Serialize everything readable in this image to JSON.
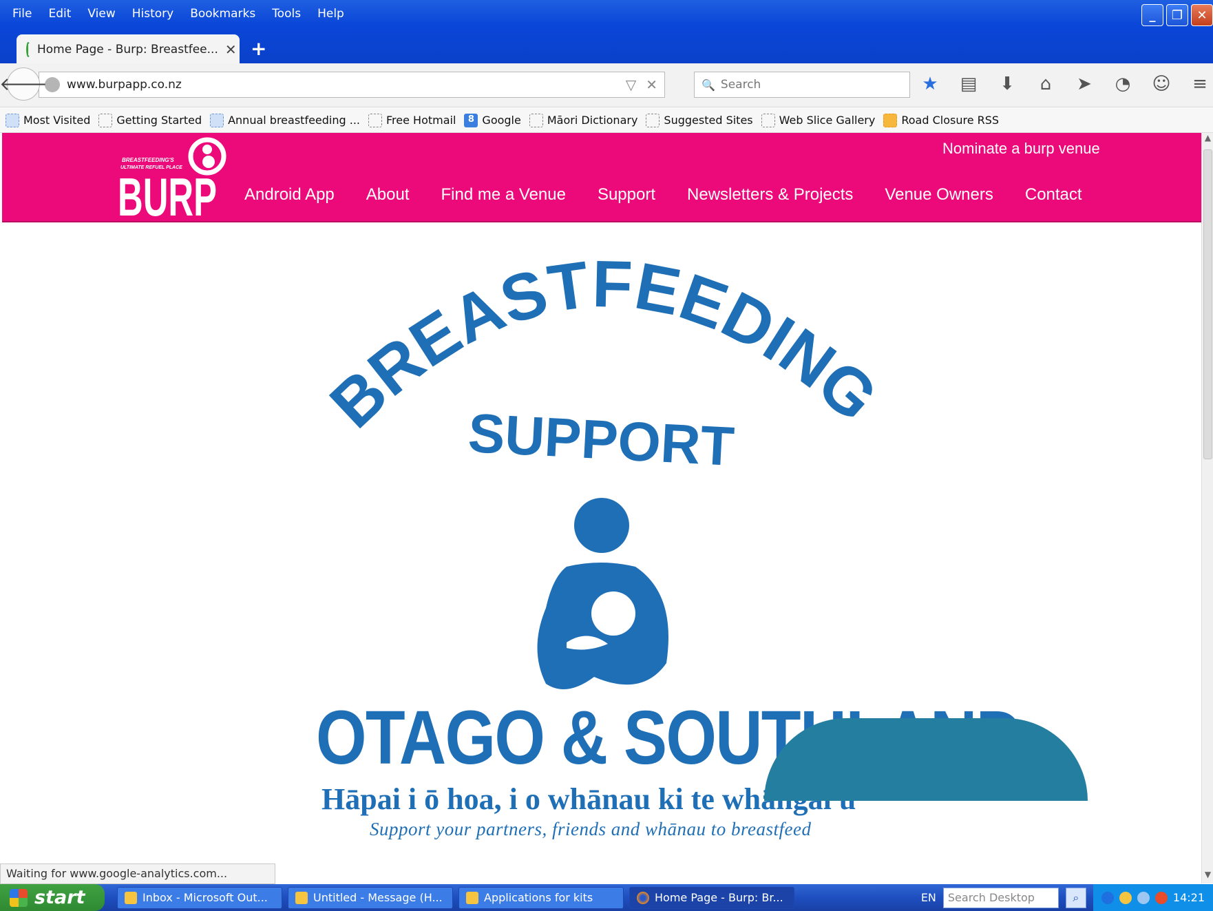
{
  "menu": [
    "File",
    "Edit",
    "View",
    "History",
    "Bookmarks",
    "Tools",
    "Help"
  ],
  "tab": {
    "title": "Home Page - Burp: Breastfee...",
    "close": "✕",
    "new": "+"
  },
  "address": {
    "url": "www.burpapp.co.nz"
  },
  "search": {
    "placeholder": "Search"
  },
  "bookmarks": [
    "Most Visited",
    "Getting Started",
    "Annual breastfeeding ...",
    "Free Hotmail",
    "Google",
    "Māori Dictionary",
    "Suggested Sites",
    "Web Slice Gallery",
    "Road Closure RSS"
  ],
  "site": {
    "logo_small_1": "BREASTFEEDING'S",
    "logo_small_2": "ULTIMATE REFUEL PLACE",
    "logo_text": "BURP",
    "nominate": "Nominate a burp venue",
    "nav": [
      "Android App",
      "About",
      "Find me a Venue",
      "Support",
      "Newsletters & Projects",
      "Venue Owners",
      "Contact"
    ]
  },
  "hero": {
    "arc_title": "BREASTFEEDING",
    "subtitle": "SUPPORT",
    "region": "OTAGO & SOUTHLAND",
    "maori": "Hāpai i ō hoa, i o whānau ki te whāngai ū",
    "english": "Support your partners, friends and whānau to breastfeed"
  },
  "status": "Waiting for www.google-analytics.com...",
  "taskbar": {
    "start": "start",
    "items": [
      "Inbox - Microsoft Out...",
      "Untitled - Message (H...",
      "Applications for kits",
      "Home Page - Burp: Br..."
    ],
    "lang": "EN",
    "search": "Search Desktop",
    "clock": "14:21"
  },
  "colors": {
    "brand_pink": "#ec0a7a",
    "hero_blue": "#1f6fb7",
    "teal": "#247ea0"
  }
}
